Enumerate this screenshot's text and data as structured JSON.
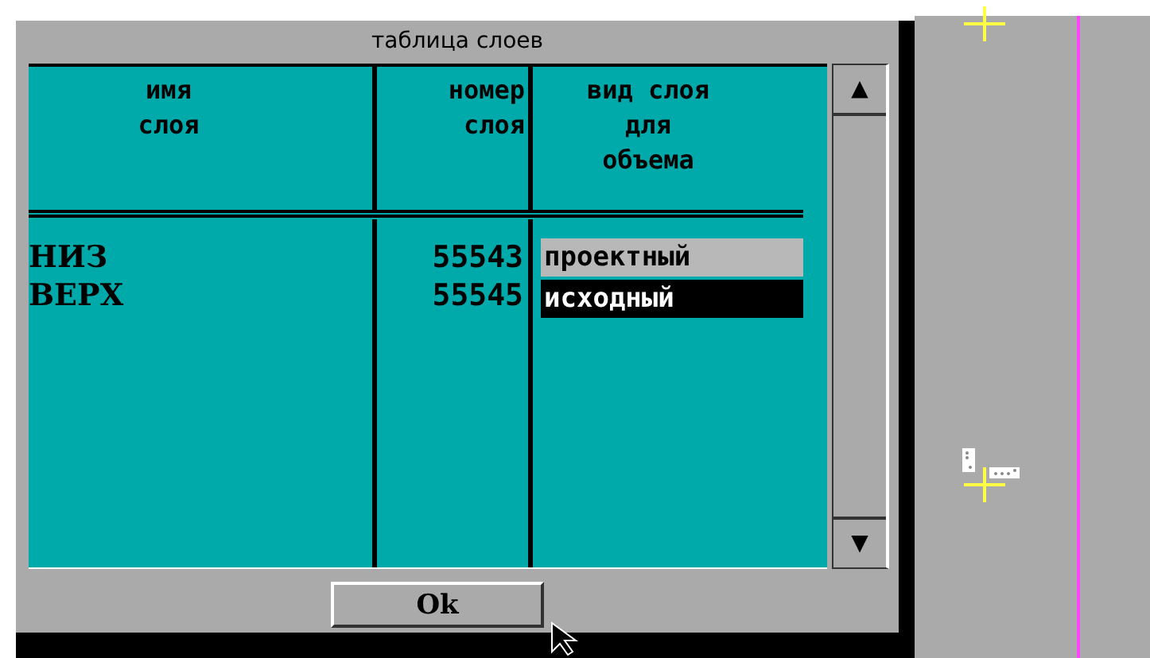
{
  "dialog": {
    "title": "таблица слоев",
    "table": {
      "columns": [
        {
          "label": "имя\nслоя"
        },
        {
          "label": "номер\nслоя"
        },
        {
          "label": "вид слоя\nдля\nобъема"
        }
      ],
      "rows": [
        {
          "name": "НИЗ",
          "number": "55543",
          "type": "проектный",
          "selected": false
        },
        {
          "name": "ВЕРХ",
          "number": "55545",
          "type": "исходный",
          "selected": true
        }
      ]
    },
    "scrollbar": {
      "up": "▲",
      "down": "▼"
    },
    "buttons": [
      "Ok"
    ]
  }
}
